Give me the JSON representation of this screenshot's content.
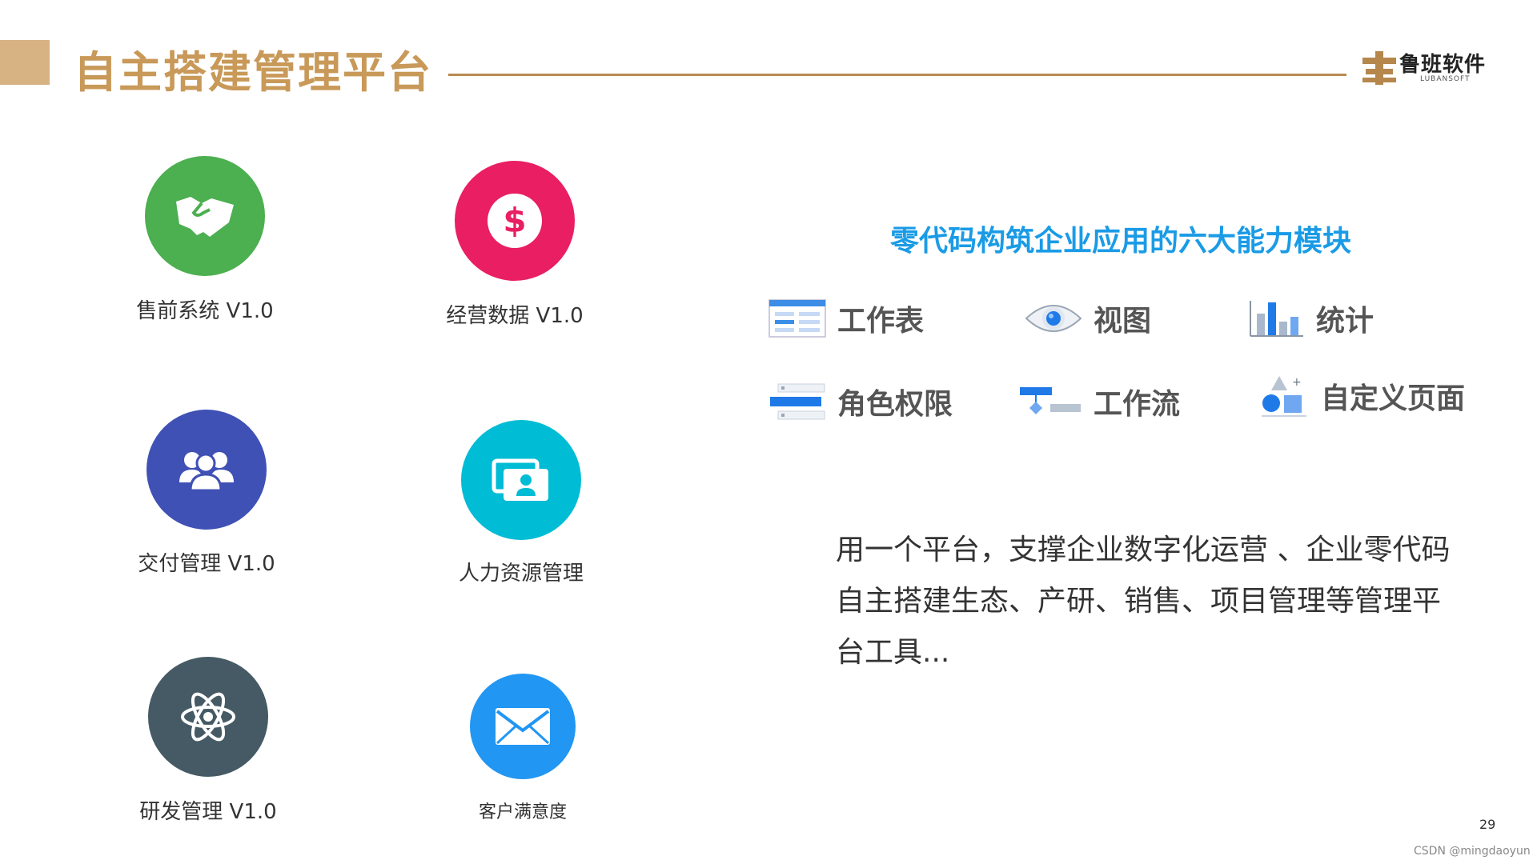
{
  "header": {
    "title": "自主搭建管理平台",
    "logo_text": "鲁班软件",
    "logo_sub": "LUBANSOFT"
  },
  "apps": [
    {
      "label": "售前系统 V1.0",
      "icon": "handshake-icon",
      "color": "#4caf50"
    },
    {
      "label": "经营数据 V1.0",
      "icon": "dollar-icon",
      "color": "#e91e63"
    },
    {
      "label": "交付管理 V1.0",
      "icon": "users-icon",
      "color": "#3f51b5"
    },
    {
      "label": "人力资源管理",
      "icon": "id-cards-icon",
      "color": "#00bcd4"
    },
    {
      "label": "研发管理 V1.0",
      "icon": "atom-icon",
      "color": "#455a64"
    },
    {
      "label": "客户满意度",
      "icon": "envelope-icon",
      "color": "#2196f3"
    }
  ],
  "right": {
    "subtitle": "零代码构筑企业应用的六大能力模块",
    "features": [
      {
        "label": "工作表",
        "icon": "worksheet-icon"
      },
      {
        "label": "视图",
        "icon": "eye-icon"
      },
      {
        "label": "统计",
        "icon": "bar-chart-icon"
      },
      {
        "label": "角色权限",
        "icon": "role-permission-icon"
      },
      {
        "label": "工作流",
        "icon": "workflow-icon"
      },
      {
        "label": "自定义页面",
        "icon": "custom-page-icon"
      }
    ],
    "description": " 用一个平台，支撑企业数字化运营 、企业零代码自主搭建生态、产研、销售、项目管理等管理平台工具..."
  },
  "footer": {
    "page_number": "29",
    "watermark": "CSDN @mingdaoyun"
  }
}
